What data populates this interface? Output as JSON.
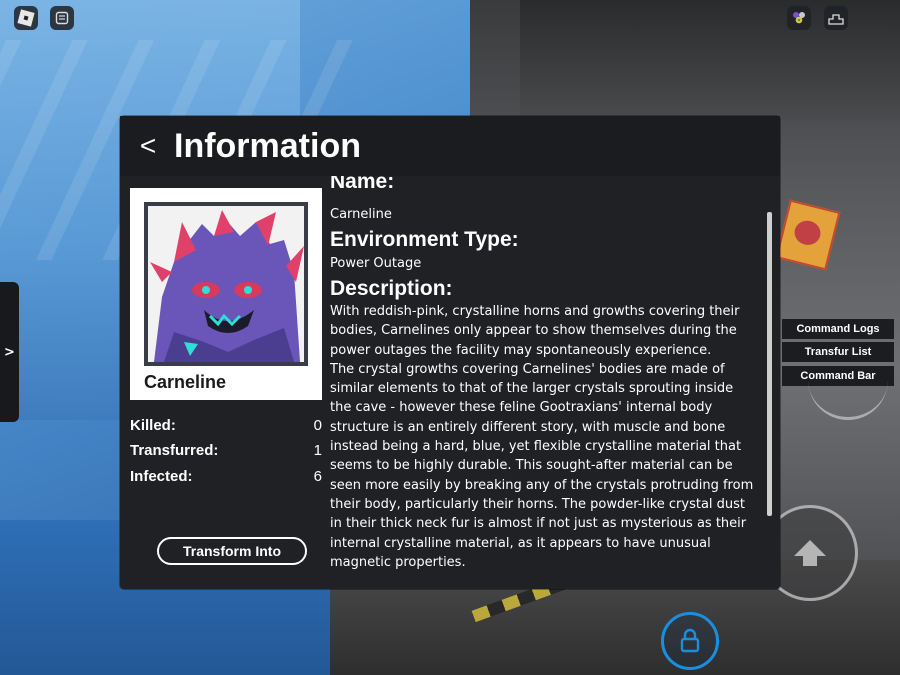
{
  "panel": {
    "back_label": "<",
    "title": "Information"
  },
  "character": {
    "name": "Carneline",
    "stats": [
      {
        "label": "Killed:",
        "value": "0"
      },
      {
        "label": "Transfurred:",
        "value": "1"
      },
      {
        "label": "Infected:",
        "value": "6"
      }
    ],
    "transform_label": "Transform Into"
  },
  "info": {
    "name_heading": "Name:",
    "name_value": "Carneline",
    "env_heading": "Environment Type:",
    "env_value": "Power Outage",
    "desc_heading": "Description:",
    "description": "With reddish-pink, crystalline horns and growths covering their bodies, Carnelines only appear to show themselves during the power outages the facility may spontaneously experience.\nThe crystal growths covering Carnelines' bodies are made of similar elements to that of the larger crystals sprouting inside the cave - however these feline Gootraxians' internal body structure is an entirely different story, with muscle and bone instead being a hard, blue, yet flexible crystalline material that seems to be highly durable. This sought-after material can be seen more easily by breaking any of the crystals protruding from their body, particularly their horns. The powder-like crystal dust in their thick neck fur is almost if not just as mysterious as their internal crystalline material, as it appears to have unusual magnetic properties."
  },
  "side_tab": {
    "label": ">"
  },
  "commands": [
    "Command Logs",
    "Transfur List",
    "Command Bar"
  ],
  "icons": {
    "top_left": [
      "roblox-menu-icon",
      "chat-icon"
    ],
    "top_right": [
      "emote-icon",
      "leaderboard-icon"
    ],
    "jump": "jump-arrow-icon",
    "shift_lock": "shift-lock-icon"
  },
  "colors": {
    "panel_bg": "#1f2124",
    "accent_blue": "#1a8fe0",
    "text": "#ffffff"
  }
}
